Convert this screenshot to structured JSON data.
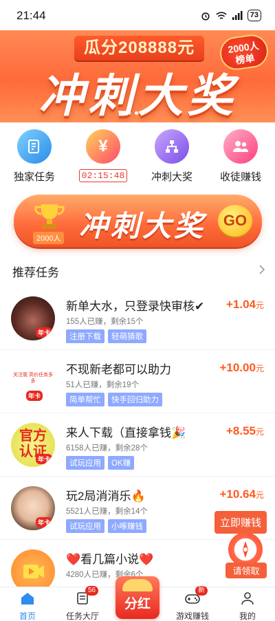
{
  "status_bar": {
    "time": "21:44",
    "battery": "73"
  },
  "banner": {
    "subtitle": "瓜分208888元",
    "title": "冲刺大奖",
    "badge_line1": "2000人",
    "badge_line2": "榜单"
  },
  "quick_menu": [
    {
      "label": "独家任务",
      "icon": "edit-icon"
    },
    {
      "label": "02:15:48",
      "icon": "yen-icon",
      "is_timer": true
    },
    {
      "label": "冲刺大奖",
      "icon": "hierarchy-icon"
    },
    {
      "label": "收徒赚钱",
      "icon": "users-icon"
    }
  ],
  "promo": {
    "title": "冲刺大奖",
    "count": "2000人",
    "go": "GO"
  },
  "section": {
    "title": "推荐任务"
  },
  "tasks": [
    {
      "title": "新单大水，只登录快审核✔",
      "meta": "155人已赚，剩余15个",
      "tags": [
        "注册下载",
        "轻萌猜歌"
      ],
      "reward": "+1.04",
      "unit": "元",
      "avatar_badge": "年卡"
    },
    {
      "title": "不现新老都可以助力",
      "meta": "51人已赚，剩余19个",
      "tags": [
        "简单帮忙",
        "快手回归助力"
      ],
      "reward": "+10.00",
      "unit": "元",
      "avatar_text": "关注我 高价任务多多",
      "avatar_badge": "年卡"
    },
    {
      "title": "来人下载（直接拿钱🎉",
      "meta": "6158人已赚，剩余28个",
      "tags": [
        "试玩应用",
        "OK赚"
      ],
      "reward": "+8.55",
      "unit": "元",
      "avatar_text": "官方认证",
      "avatar_badge": "年卡"
    },
    {
      "title": "玩2局消消乐🔥",
      "meta": "5521人已赚，剩余14个",
      "tags": [
        "试玩应用",
        "小啄赚钱"
      ],
      "reward": "+10.64",
      "unit": "元",
      "button": "立即赚钱",
      "avatar_badge": "年卡"
    },
    {
      "title": "❤️看几篇小说❤️",
      "meta": "4280人已赚，剩余6个",
      "tags": [],
      "reward": "",
      "unit": "元"
    }
  ],
  "floating": {
    "label": "请领取"
  },
  "bottom_nav": {
    "items": [
      {
        "label": "首页",
        "active": true
      },
      {
        "label": "任务大厅",
        "badge": "56"
      },
      {
        "label": "分红",
        "center": true
      },
      {
        "label": "游戏赚钱",
        "badge": "新"
      },
      {
        "label": "我的"
      }
    ]
  },
  "colors": {
    "accent": "#ff5a1f",
    "nav_active": "#2f8cf0",
    "tag": "#8ea9ff"
  }
}
